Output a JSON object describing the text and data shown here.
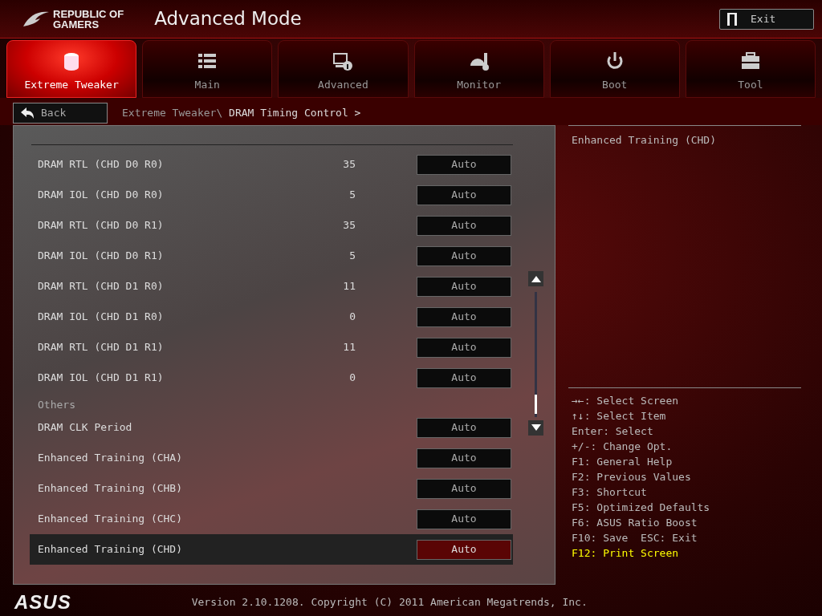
{
  "logo": {
    "line1": "REPUBLIC OF",
    "line2": "GAMERS"
  },
  "window": {
    "title": "Advanced Mode"
  },
  "exit_button": {
    "label": "Exit"
  },
  "tabs": [
    {
      "label": "Extreme Tweaker",
      "selected": true
    },
    {
      "label": "Main",
      "selected": false
    },
    {
      "label": "Advanced",
      "selected": false
    },
    {
      "label": "Monitor",
      "selected": false
    },
    {
      "label": "Boot",
      "selected": false
    },
    {
      "label": "Tool",
      "selected": false
    }
  ],
  "back_button": {
    "label": "Back"
  },
  "breadcrumb": {
    "path": "Extreme Tweaker\\",
    "current": "DRAM Timing Control >"
  },
  "items": [
    {
      "kind": "setting",
      "label": "DRAM RTL (CHD D0 R0)",
      "value": "35",
      "option": "Auto",
      "selected": false
    },
    {
      "kind": "setting",
      "label": "DRAM IOL (CHD D0 R0)",
      "value": "5",
      "option": "Auto",
      "selected": false
    },
    {
      "kind": "setting",
      "label": "DRAM RTL (CHD D0 R1)",
      "value": "35",
      "option": "Auto",
      "selected": false
    },
    {
      "kind": "setting",
      "label": "DRAM IOL (CHD D0 R1)",
      "value": "5",
      "option": "Auto",
      "selected": false
    },
    {
      "kind": "setting",
      "label": "DRAM RTL (CHD D1 R0)",
      "value": "11",
      "option": "Auto",
      "selected": false
    },
    {
      "kind": "setting",
      "label": "DRAM IOL (CHD D1 R0)",
      "value": "0",
      "option": "Auto",
      "selected": false
    },
    {
      "kind": "setting",
      "label": "DRAM RTL (CHD D1 R1)",
      "value": "11",
      "option": "Auto",
      "selected": false
    },
    {
      "kind": "setting",
      "label": "DRAM IOL (CHD D1 R1)",
      "value": "0",
      "option": "Auto",
      "selected": false
    },
    {
      "kind": "section",
      "label": "Others"
    },
    {
      "kind": "setting",
      "label": "DRAM CLK Period",
      "option": "Auto",
      "selected": false
    },
    {
      "kind": "setting",
      "label": "Enhanced Training (CHA)",
      "option": "Auto",
      "selected": false
    },
    {
      "kind": "setting",
      "label": "Enhanced Training (CHB)",
      "option": "Auto",
      "selected": false
    },
    {
      "kind": "setting",
      "label": "Enhanced Training (CHC)",
      "option": "Auto",
      "selected": false
    },
    {
      "kind": "setting",
      "label": "Enhanced Training (CHD)",
      "option": "Auto",
      "selected": true
    }
  ],
  "help": {
    "description": "Enhanced Training (CHD)",
    "keys": [
      {
        "text": "→←: Select Screen",
        "highlight": false
      },
      {
        "text": "↑↓: Select Item",
        "highlight": false
      },
      {
        "text": "Enter: Select",
        "highlight": false
      },
      {
        "text": "+/-: Change Opt.",
        "highlight": false
      },
      {
        "text": "F1: General Help",
        "highlight": false
      },
      {
        "text": "F2: Previous Values",
        "highlight": false
      },
      {
        "text": "F3: Shortcut",
        "highlight": false
      },
      {
        "text": "F5: Optimized Defaults",
        "highlight": false
      },
      {
        "text": "F6: ASUS Ratio Boost",
        "highlight": false
      },
      {
        "text": "F10: Save  ESC: Exit",
        "highlight": false
      },
      {
        "text": "F12: Print Screen",
        "highlight": true
      }
    ]
  },
  "footer": {
    "brand": "ASUS",
    "version": "Version 2.10.1208. Copyright (C) 2011 American Megatrends, Inc."
  }
}
